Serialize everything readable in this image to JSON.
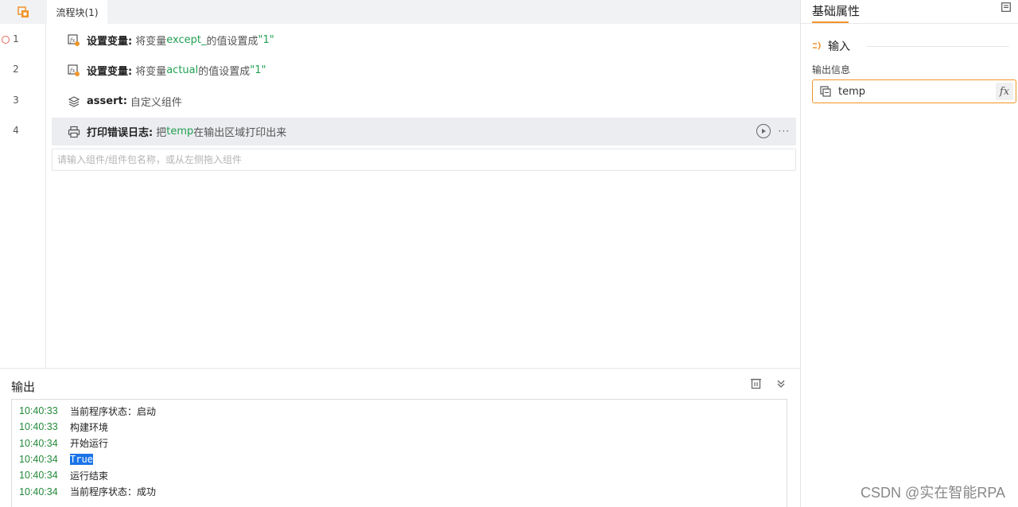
{
  "tabs": [
    {
      "label": "流程块(1)",
      "icon": "orange-block-icon"
    }
  ],
  "gutter": {
    "lines": [
      "1",
      "2",
      "3",
      "4"
    ],
    "breakpoint_line": 1
  },
  "flow_rows": [
    {
      "icon": "set-variable-icon",
      "title": "设置变量:",
      "pre": "将变量",
      "kw": "except_",
      "post": "的值设置成",
      "value": "\"1\""
    },
    {
      "icon": "set-variable-icon",
      "title": "设置变量:",
      "pre": "将变量",
      "kw": "actual",
      "post": "的值设置成",
      "value": "\"1\""
    },
    {
      "icon": "layers-icon",
      "title": "assert:",
      "pre": "自定义组件",
      "kw": "",
      "post": "",
      "value": ""
    },
    {
      "icon": "printer-icon",
      "title": "打印错误日志:",
      "pre": "把",
      "kw": "temp",
      "post": "在输出区域打印出来",
      "value": ""
    }
  ],
  "component_search": {
    "placeholder": "请输入组件/组件包名称，或从左侧拖入组件"
  },
  "output": {
    "title": "输出",
    "logs": [
      {
        "time": "10:40:33",
        "msg": "当前程序状态：启动"
      },
      {
        "time": "10:40:33",
        "msg": "构建环境"
      },
      {
        "time": "10:40:34",
        "msg": "开始运行"
      },
      {
        "time": "10:40:34",
        "msg": "True",
        "highlight": true
      },
      {
        "time": "10:40:34",
        "msg": "运行结束"
      },
      {
        "time": "10:40:34",
        "msg": "当前程序状态：成功"
      }
    ]
  },
  "props": {
    "title": "基础属性",
    "section": "输入",
    "field_label": "输出信息",
    "field_value": "temp",
    "fx_label": "fx"
  },
  "watermark": "CSDN @实在智能RPA",
  "colors": {
    "accent": "#f0952a",
    "keyword": "#22a052",
    "log_time": "#23893a",
    "selection": "#1a73e8"
  }
}
